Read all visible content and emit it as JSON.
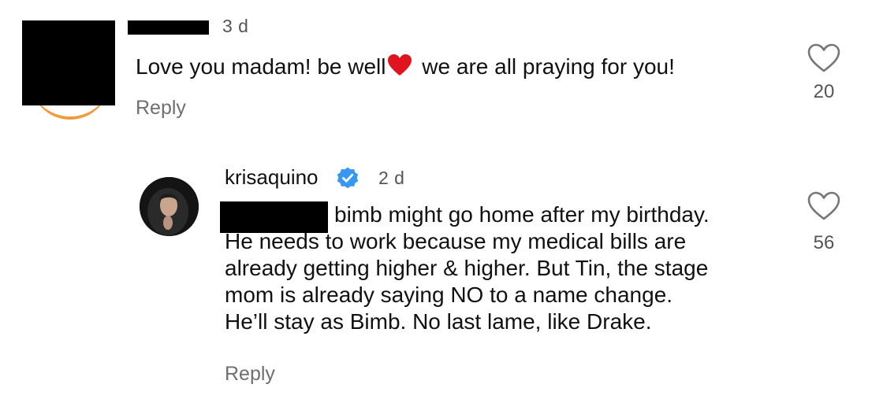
{
  "comment": {
    "timestamp": "3 d",
    "text_before": "Love you madam! be well",
    "heart_emoji": "red-heart-emoji",
    "text_after": " we are all praying for you!",
    "reply_label": "Reply",
    "like_count": "20",
    "redacted_avatar": true,
    "redacted_username": true
  },
  "reply": {
    "username": "krisaquino",
    "verified_badge": "verified-icon",
    "timestamp": "2 d",
    "lines": [
      "bimb might go home after my birthday.",
      "He needs to work because my medical bills are",
      "already getting higher & higher. But Tin, the stage",
      "mom is already saying NO to a name change.",
      "He’ll stay as Bimb. No last lame, like Drake."
    ],
    "reply_label": "Reply",
    "like_count": "56",
    "redacted_mention": true
  },
  "colors": {
    "text": "#111111",
    "muted": "#6f6f6f",
    "verified_blue": "#3897f0",
    "heart_red": "#e0141e",
    "story_ring": "#f39a3a"
  }
}
